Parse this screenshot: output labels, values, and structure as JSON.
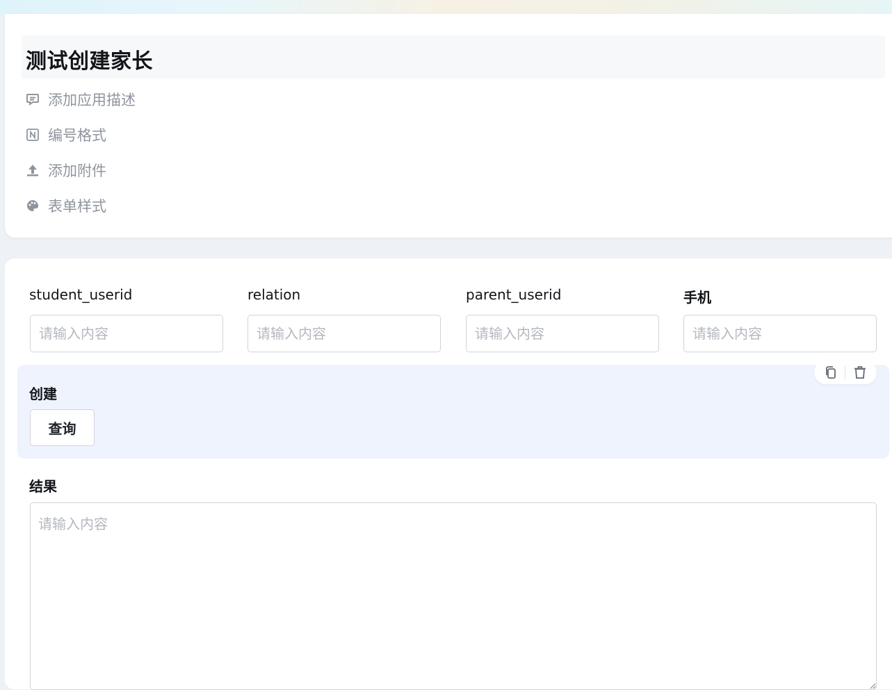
{
  "header": {
    "title": "测试创建家长",
    "actions": [
      {
        "label": "添加应用描述",
        "icon": "comment-icon"
      },
      {
        "label": "编号格式",
        "icon": "number-format-icon"
      },
      {
        "label": "添加附件",
        "icon": "upload-icon"
      },
      {
        "label": "表单样式",
        "icon": "palette-icon"
      }
    ]
  },
  "form": {
    "fields": [
      {
        "label": "student_userid",
        "placeholder": "请输入内容"
      },
      {
        "label": "relation",
        "placeholder": "请输入内容"
      },
      {
        "label": "parent_userid",
        "placeholder": "请输入内容"
      },
      {
        "label": "手机",
        "placeholder": "请输入内容"
      }
    ],
    "action_section": {
      "label": "创建",
      "button_label": "查询",
      "toolbar_icons": [
        "copy-icon",
        "trash-icon"
      ]
    },
    "result": {
      "label": "结果",
      "placeholder": "请输入内容"
    }
  },
  "colors": {
    "section_bg": "#eef3fd",
    "muted_text": "#8f959e",
    "border": "#d0d3d9"
  }
}
